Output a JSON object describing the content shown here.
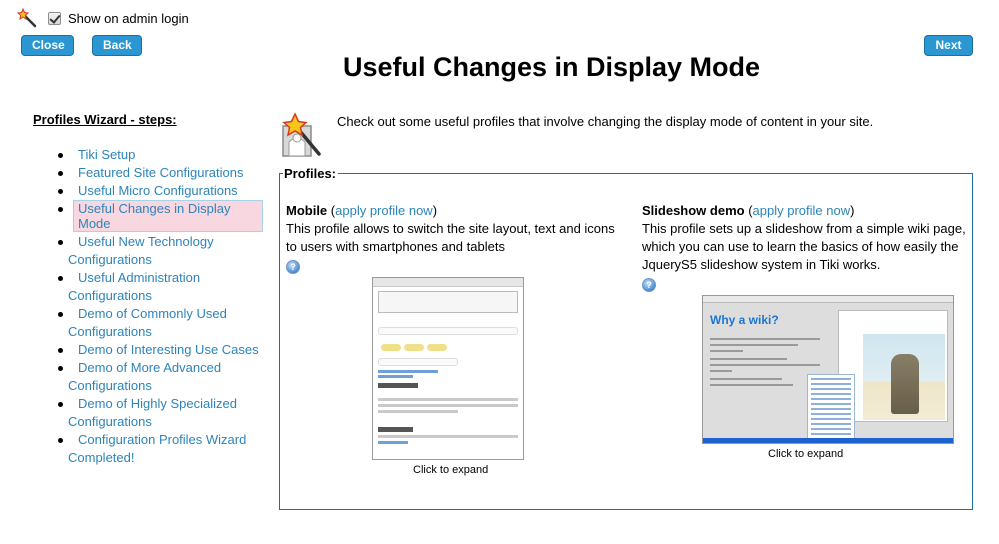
{
  "topbar": {
    "wand_icon": "magic-wand-icon",
    "show_on_admin_login": {
      "label": "Show on admin login",
      "checked": true
    }
  },
  "buttons": {
    "close": "Close",
    "back": "Back",
    "next": "Next"
  },
  "page_title": "Useful Changes in Display Mode",
  "sidebar": {
    "title": "Profiles Wizard - steps:",
    "steps": [
      {
        "label": "Tiki Setup",
        "cont": ""
      },
      {
        "label": "Featured Site Configurations",
        "cont": ""
      },
      {
        "label": "Useful Micro Configurations",
        "cont": ""
      },
      {
        "label": "Useful Changes in Display Mode",
        "cont": "",
        "active": true
      },
      {
        "label": "Useful New Technology",
        "cont": "Configurations"
      },
      {
        "label": "Useful Administration",
        "cont": "Configurations"
      },
      {
        "label": "Demo of Commonly Used",
        "cont": "Configurations"
      },
      {
        "label": "Demo of Interesting Use Cases",
        "cont": ""
      },
      {
        "label": "Demo of More Advanced",
        "cont": "Configurations"
      },
      {
        "label": "Demo of Highly Specialized",
        "cont": "Configurations"
      },
      {
        "label": "Configuration Profiles Wizard",
        "cont": "Completed!"
      }
    ]
  },
  "intro": {
    "icon": "wizard-icon",
    "text": "Check out some useful profiles that involve changing the display mode of content in your site."
  },
  "profiles": {
    "legend": "Profiles:",
    "items": [
      {
        "name": "Mobile",
        "apply_link": "apply profile now",
        "description": "This profile allows to switch the site layout, text and icons to users with smartphones and tablets",
        "help_icon": "help-icon",
        "caption": "Click to expand"
      },
      {
        "name": "Slideshow demo",
        "apply_link": "apply profile now",
        "description": "This profile sets up a slideshow from a simple wiki page, which you can use to learn the basics of how easily the JqueryS5 slideshow system in Tiki works.",
        "help_icon": "help-icon",
        "caption": "Click to expand",
        "thumbnail_title": "Why a wiki?"
      }
    ]
  },
  "colors": {
    "button_bg": "#2a96d2",
    "link": "#2c84b9",
    "fieldset_border": "#1c6f9f",
    "active_step_bg": "#f8d7e0"
  }
}
